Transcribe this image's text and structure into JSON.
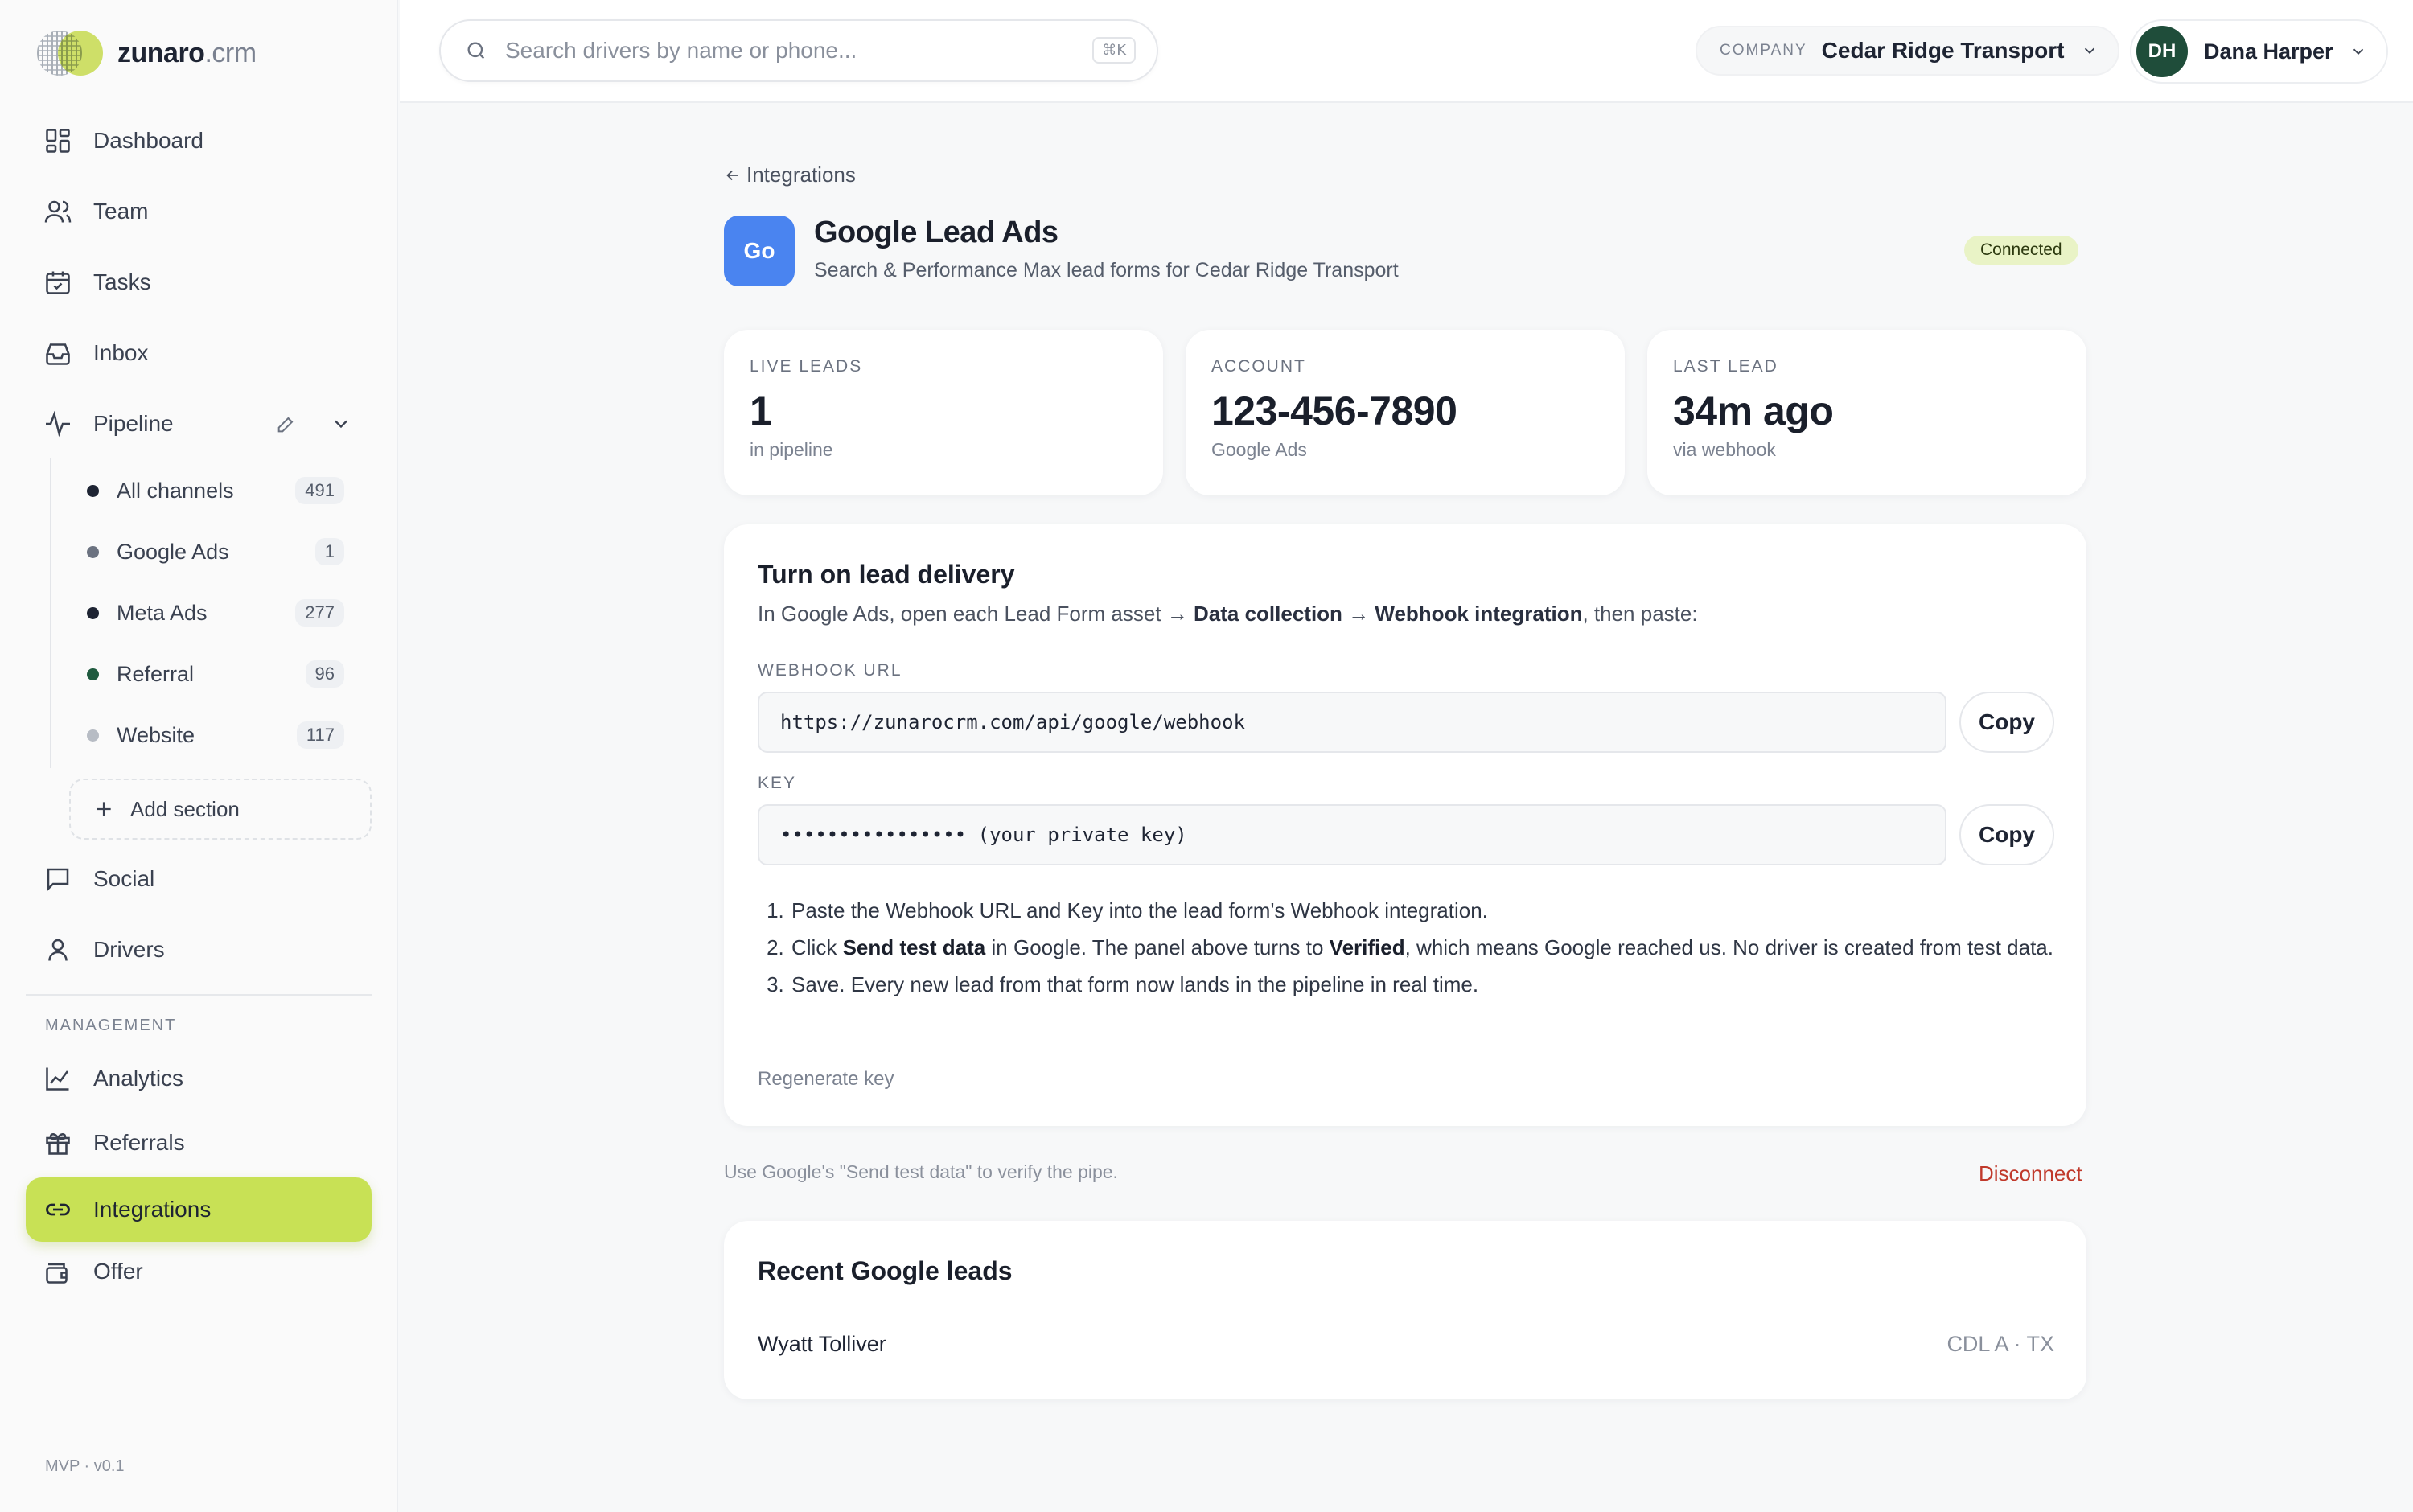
{
  "brand": {
    "name": "zunaro",
    "suffix": ".crm"
  },
  "nav": {
    "dashboard": "Dashboard",
    "team": "Team",
    "tasks": "Tasks",
    "inbox": "Inbox",
    "pipeline": "Pipeline",
    "social": "Social",
    "drivers": "Drivers",
    "analytics": "Analytics",
    "referrals": "Referrals",
    "integrations": "Integrations",
    "offer": "Offer"
  },
  "pipeline_sections": [
    {
      "label": "All channels",
      "count": "491",
      "color": "#1e2433"
    },
    {
      "label": "Google Ads",
      "count": "1",
      "color": "#6b7280"
    },
    {
      "label": "Meta Ads",
      "count": "277",
      "color": "#1e2433"
    },
    {
      "label": "Referral",
      "count": "96",
      "color": "#1f5a3f"
    },
    {
      "label": "Website",
      "count": "117",
      "color": "#b7bcc4"
    }
  ],
  "add_section": "Add section",
  "management_label": "MANAGEMENT",
  "version": "MVP · v0.1",
  "search": {
    "placeholder": "Search drivers by name or phone...",
    "shortcut": "⌘K"
  },
  "company": {
    "label": "COMPANY",
    "value": "Cedar Ridge Transport"
  },
  "user": {
    "initials": "DH",
    "name": "Dana Harper"
  },
  "back_link": "Integrations",
  "integration": {
    "icon": "Go",
    "title": "Google Lead Ads",
    "subtitle": "Search & Performance Max lead forms for Cedar Ridge Transport",
    "status": "Connected"
  },
  "stats": [
    {
      "key": "LIVE LEADS",
      "value": "1",
      "sub": "in pipeline"
    },
    {
      "key": "ACCOUNT",
      "value": "123-456-7890",
      "sub": "Google Ads"
    },
    {
      "key": "LAST LEAD",
      "value": "34m ago",
      "sub": "via webhook"
    }
  ],
  "delivery": {
    "title": "Turn on lead delivery",
    "intro_pre": "In Google Ads, open each Lead Form asset → ",
    "intro_b1": "Data collection",
    "intro_mid": " → ",
    "intro_b2": "Webhook integration",
    "intro_post": ", then paste:",
    "webhook_label": "WEBHOOK URL",
    "webhook_url": "https://zunarocrm.com/api/google/webhook",
    "key_label": "KEY",
    "key_value": "••••••••••••••••  (your private key)",
    "copy_label": "Copy",
    "step1": "Paste the Webhook URL and Key into the lead form's Webhook integration.",
    "step2_pre": "Click ",
    "step2_b1": "Send test data",
    "step2_mid": " in Google. The panel above turns to ",
    "step2_b2": "Verified",
    "step2_post": ", which means Google reached us. No driver is created from test data.",
    "step3": "Save. Every new lead from that form now lands in the pipeline in real time.",
    "regenerate": "Regenerate key"
  },
  "footnote": "Use Google's \"Send test data\" to verify the pipe.",
  "disconnect": "Disconnect",
  "recent": {
    "title": "Recent Google leads",
    "leads": [
      {
        "name": "Wyatt Tolliver",
        "tags": "CDL A · TX"
      }
    ]
  }
}
